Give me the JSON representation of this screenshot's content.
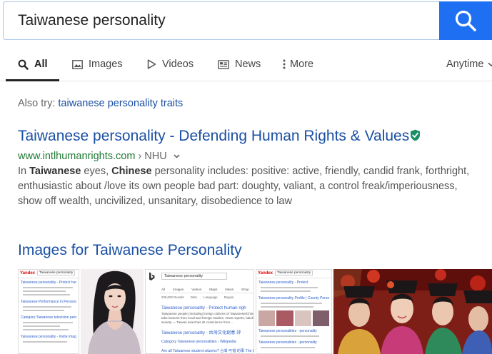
{
  "search": {
    "query": "Taiwanese personality"
  },
  "tabs": [
    {
      "label": "All",
      "icon": "search-icon",
      "active": true
    },
    {
      "label": "Images",
      "icon": "image-icon",
      "active": false
    },
    {
      "label": "Videos",
      "icon": "play-icon",
      "active": false
    },
    {
      "label": "News",
      "icon": "newspaper-icon",
      "active": false
    },
    {
      "label": "More",
      "icon": "more-vertical-icon",
      "active": false
    }
  ],
  "time_filter": {
    "label": "Anytime",
    "icon": "chevron-down-icon"
  },
  "also_try": {
    "prefix": "Also try:",
    "link": "taiwanese personality traits"
  },
  "result": {
    "title": "Taiwanese personality - Defending Human Rights & Values",
    "verified_icon": "shield-check-icon",
    "domain": "www.intlhumanrights.com",
    "breadcrumb": " › NHU",
    "snippet": {
      "s1": "In ",
      "b1": "Taiwanese",
      "s2": " eyes, ",
      "b2": "Chinese",
      "s3": " personality includes: positive: active, friendly, candid frank, forthright,",
      "line2": "enthusiastic about /love its own people bad part: doughty, valiant, a control freak/imperiousness,",
      "line3": "show off wealth, uncivilized, unsanitary, disobedience to law"
    }
  },
  "images": {
    "heading": "Images for Taiwanese Personality",
    "thumb1": {
      "logo": "Yandex",
      "query": "Taiwanese personality",
      "r1": "Taiwanese personality - Protect human rig",
      "r2": "Taiwanese Performance in Personality",
      "r3": "Category:Taiwanese television personalit",
      "r4": "Taiwanese personality - Invite image"
    },
    "thumb3": {
      "query": "Taiwanese personality",
      "menu": [
        "All",
        "Images",
        "Videos",
        "Maps",
        "News",
        "Shop"
      ],
      "result_count": "200,000 Results",
      "filters": [
        "Date",
        "Language",
        "Region"
      ],
      "r1": "Taiwanese personality - Protect human righ",
      "r2": "Taiwanese people (including foreign citizens of Taiwanese/Chinese",
      "r3": "take lessons from local and foreign studies, news reports, black-list",
      "r4": "society — Taiwan searches its conscience from...",
      "r5": "Taiwanese personality - 台灣文化創意 評",
      "r6": "Category Taiwanese personalities - Wikipedia",
      "r7": "Are all Taiwanese student citizens? 台灣 可惜 的事 The Liberi"
    },
    "thumb5": {
      "logo": "Yandex",
      "query": "Taiwanese personality",
      "r1": "Taiwanese personality - Protect",
      "r2": "Taiwanese personality Profile | County Personality",
      "r3": "Taiwanese personalities - personality",
      "r4": "Taiwanese personalities - personality"
    }
  },
  "colors": {
    "link": "#1a4fa3",
    "url_green": "#1f7a34",
    "search_button": "#1e6ff1",
    "verified": "#1b8f63"
  }
}
